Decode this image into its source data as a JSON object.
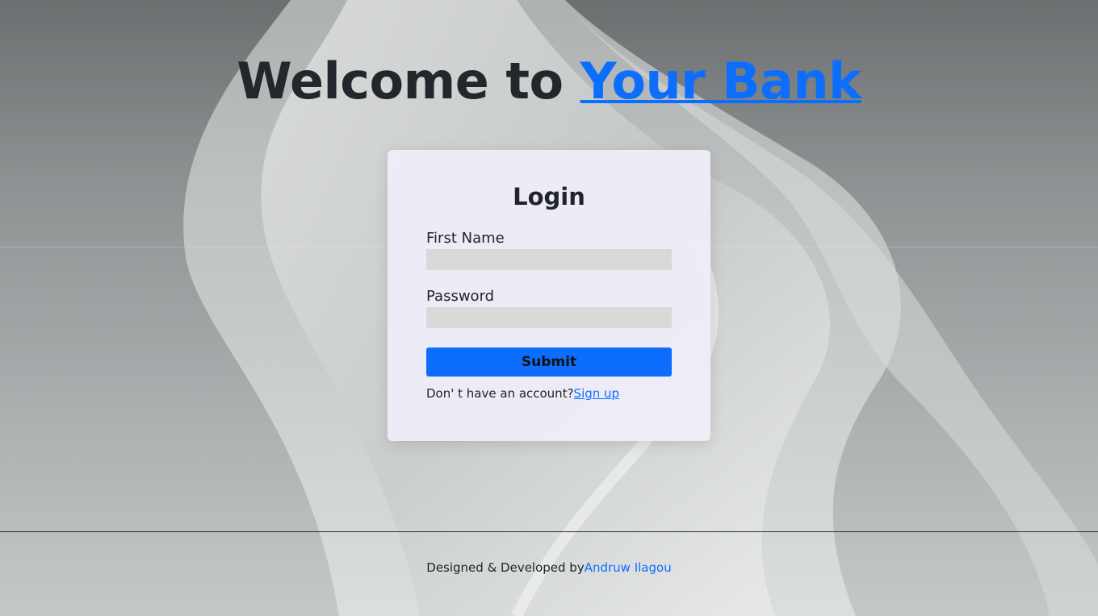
{
  "header": {
    "title_prefix": "Welcome to ",
    "title_link": "Your Bank"
  },
  "login": {
    "heading": "Login",
    "first_name_label": "First Name",
    "first_name_value": "",
    "password_label": "Password",
    "password_value": "",
    "submit_label": "Submit",
    "signup_prompt": "Don' t have an account?",
    "signup_link": "Sign up"
  },
  "footer": {
    "credit_prefix": "Designed & Developed by",
    "credit_link": "Andruw Ilagou"
  },
  "colors": {
    "accent": "#0d6efd",
    "input_bg": "#d9d9d9",
    "card_bg": "#eeecf8"
  }
}
